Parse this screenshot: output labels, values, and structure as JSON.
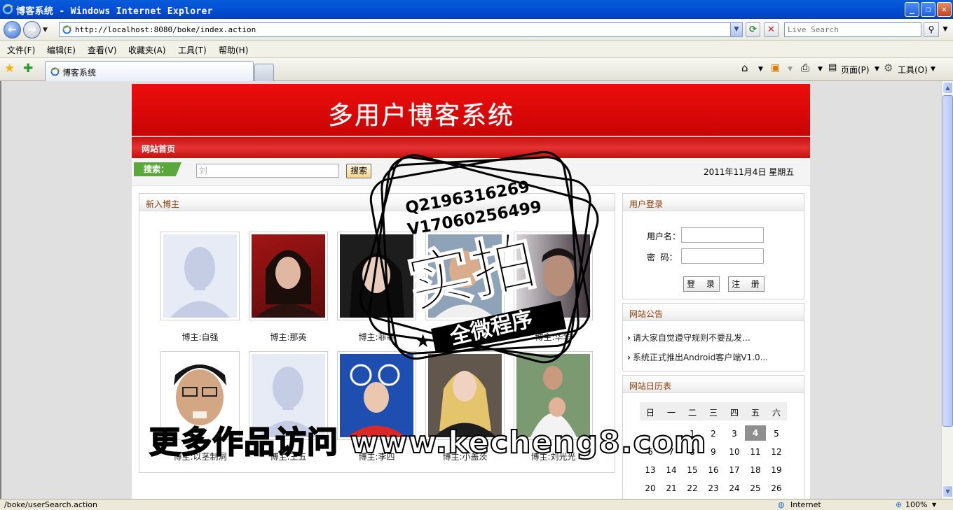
{
  "window": {
    "title": "博客系统 - Windows Internet Explorer"
  },
  "address": {
    "url": "http://localhost:8080/boke/index.action"
  },
  "search_provider": {
    "placeholder": "Live Search"
  },
  "menu": [
    "文件(F)",
    "编辑(E)",
    "查看(V)",
    "收藏夹(A)",
    "工具(T)",
    "帮助(H)"
  ],
  "tab": {
    "label": "博客系统"
  },
  "command_bar": {
    "page": "页面(P)",
    "tools": "工具(O)"
  },
  "site": {
    "title": "多用户博客系统",
    "nav_home": "网站首页",
    "search_label": "搜索：",
    "search_value": "刘",
    "search_button": "搜索",
    "date": "2011年11月4日 星期五"
  },
  "new_bloggers": {
    "heading": "新入博主",
    "items": [
      {
        "name": "博主:自强"
      },
      {
        "name": "博主:那英"
      },
      {
        "name": "博主:菲菲"
      },
      {
        "name": ""
      },
      {
        "name": "博主:华华"
      },
      {
        "name": "博主:以茎制洞"
      },
      {
        "name": "博主:王五"
      },
      {
        "name": "博主:李四"
      },
      {
        "name": "博主:小盖茨"
      },
      {
        "name": "博主:刘光光"
      }
    ]
  },
  "login": {
    "heading": "用户登录",
    "username_label": "用户名：",
    "password_label": "密  码：",
    "login_button": "登 录",
    "register_button": "注 册"
  },
  "announcements": {
    "heading": "网站公告",
    "items": [
      "请大家自觉遵守规则不要乱发…",
      "系统正式推出Android客户端V1.0..."
    ]
  },
  "calendar": {
    "heading": "网站日历表",
    "weekdays": [
      "日",
      "一",
      "二",
      "三",
      "四",
      "五",
      "六"
    ],
    "today": "4",
    "rows": [
      [
        "",
        "",
        "1",
        "2",
        "3",
        "4",
        "5"
      ],
      [
        "6",
        "7",
        "8",
        "9",
        "10",
        "11",
        "12"
      ],
      [
        "13",
        "14",
        "15",
        "16",
        "17",
        "18",
        "19"
      ],
      [
        "20",
        "21",
        "22",
        "23",
        "24",
        "25",
        "26"
      ]
    ]
  },
  "status": {
    "text": "/boke/userSearch.action",
    "zone": "Internet",
    "zoom": "100%"
  },
  "watermark": {
    "phone1": "Q2196316269",
    "phone2": "V17060256499",
    "stamp": "实拍",
    "ribbon": "全微程序",
    "footer": "更多作品访问 www.kecheng8.com"
  },
  "colors": {
    "banner_red": "#e00a0a",
    "search_green": "#5aa83a",
    "heading_brown": "#8c3b06"
  }
}
